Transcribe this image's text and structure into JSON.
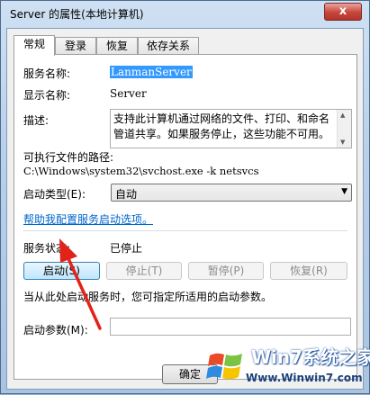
{
  "window": {
    "title": "Server 的属性(本地计算机)",
    "close_symbol": "x"
  },
  "tabs": [
    {
      "label": "常规",
      "active": true
    },
    {
      "label": "登录",
      "active": false
    },
    {
      "label": "恢复",
      "active": false
    },
    {
      "label": "依存关系",
      "active": false
    }
  ],
  "general": {
    "service_name_label": "服务名称:",
    "service_name_value": "LanmanServer",
    "display_name_label": "显示名称:",
    "display_name_value": "Server",
    "description_label": "描述:",
    "description_value": "支持此计算机通过网络的文件、打印、和命名管道共享。如果服务停止，这些功能不可用。",
    "exe_path_label": "可执行文件的路径:",
    "exe_path_value": "C:\\Windows\\system32\\svchost.exe -k netsvcs",
    "startup_type_label": "启动类型(E):",
    "startup_type_value": "自动",
    "help_link": "帮助我配置服务启动选项。",
    "status_label": "服务状态:",
    "status_value": "已停止",
    "buttons": {
      "start": "启动(S)",
      "stop": "停止(T)",
      "pause": "暂停(P)",
      "resume": "恢复(R)"
    },
    "hint_text": "当从此处启动服务时，您可指定所适用的启动参数。",
    "start_params_label": "启动参数(M):",
    "start_params_value": ""
  },
  "footer": {
    "ok": "确定"
  },
  "watermark": {
    "title": "Win7系统之家",
    "url": "Www.Winwin7.com"
  },
  "colors": {
    "title_bar": "#b9d0ea",
    "close_button": "#c8453a",
    "selection": "#3399ff",
    "link": "#0066cc",
    "arrow": "#e2231a"
  }
}
